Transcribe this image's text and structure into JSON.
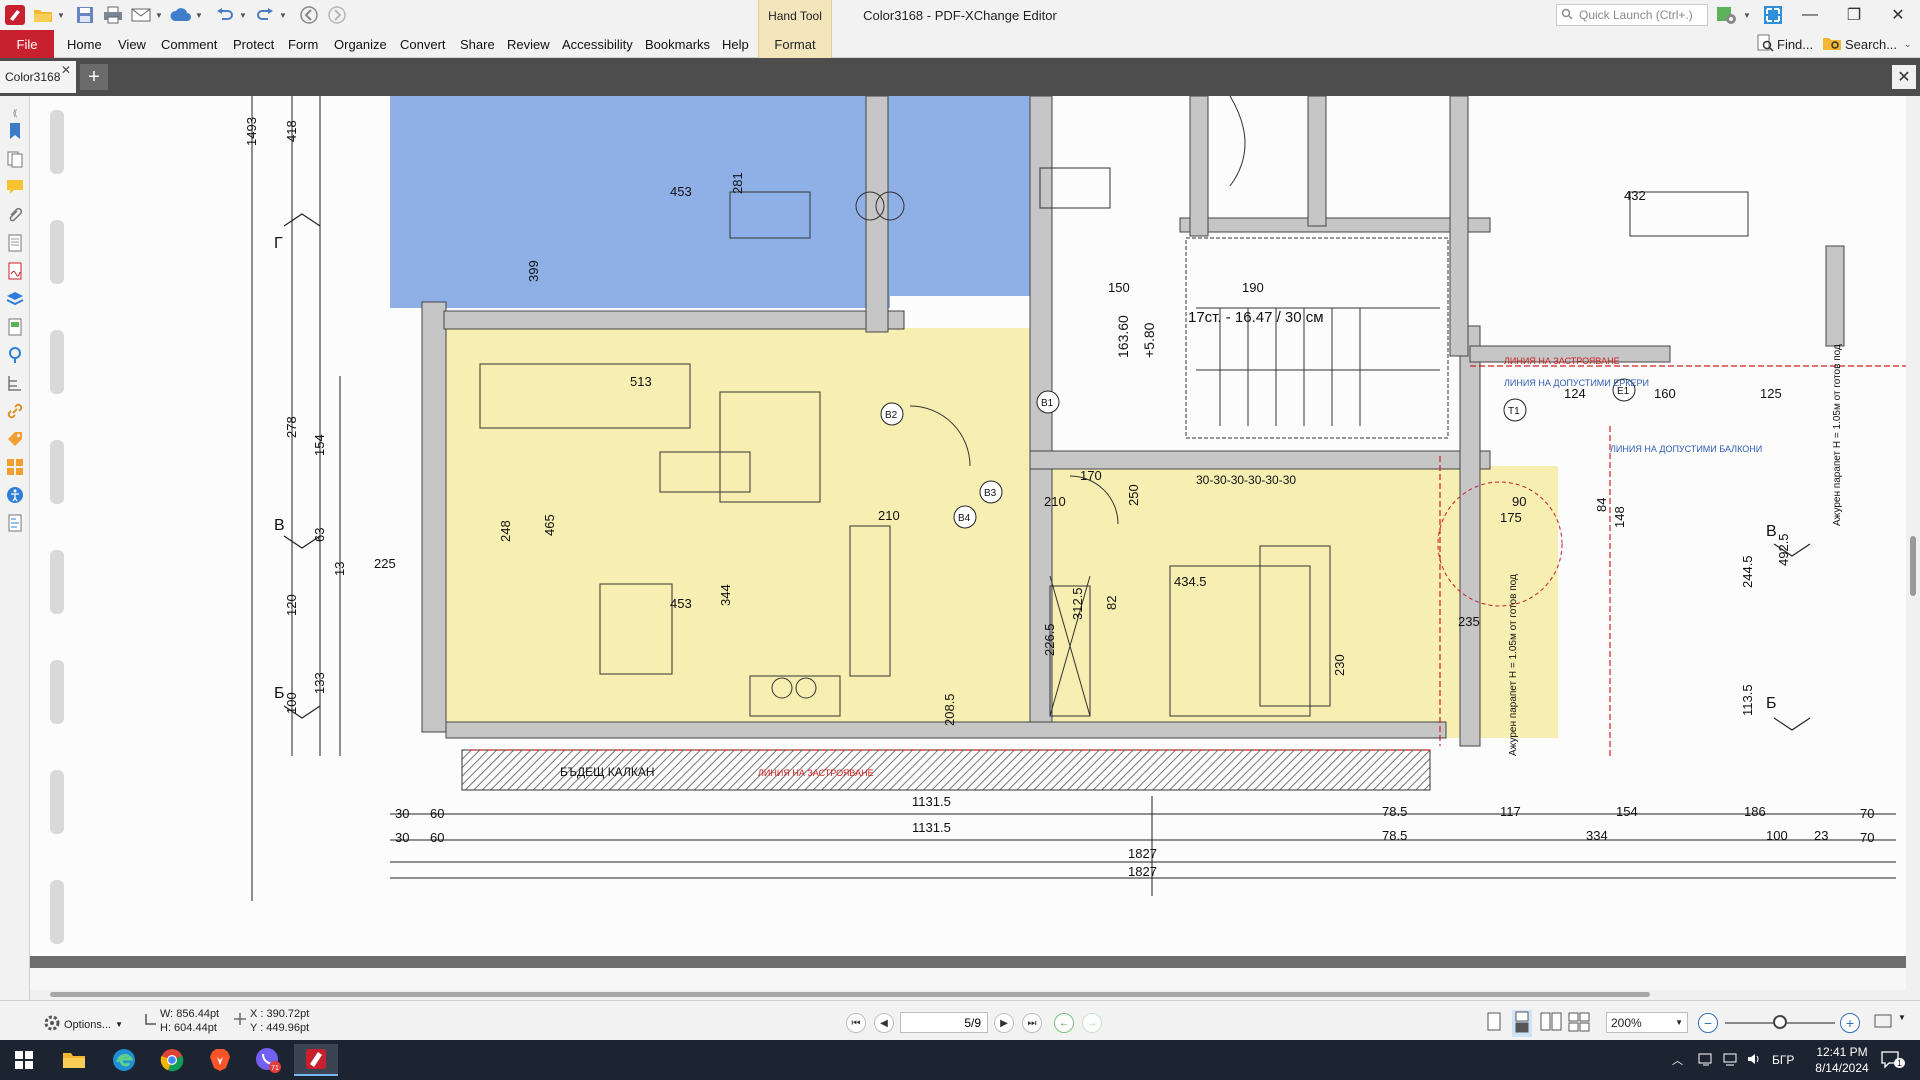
{
  "window": {
    "title": "Color3168 - PDF-XChange Editor",
    "minimize_icon": "minimize-icon",
    "restore_icon": "restore-icon",
    "close_icon": "close-icon"
  },
  "context_tab": {
    "title": "Hand Tool",
    "label": "Format"
  },
  "quick_launch": {
    "placeholder": "Quick Launch (Ctrl+.)"
  },
  "menu": {
    "file": "File",
    "items": [
      "Home",
      "View",
      "Comment",
      "Protect",
      "Form",
      "Organize",
      "Convert",
      "Share",
      "Review",
      "Accessibility",
      "Bookmarks",
      "Help"
    ]
  },
  "ribbon_right": {
    "find": "Find...",
    "search": "Search..."
  },
  "tabs": {
    "document": "Color3168"
  },
  "status": {
    "options": "Options...",
    "width": "W: 856.44pt",
    "height": "H: 604.44pt",
    "x": "X : 390.72pt",
    "y": "Y : 449.96pt",
    "page": "5/9",
    "zoom": "200%"
  },
  "taskbar": {
    "time": "12:41 PM",
    "date": "8/14/2024",
    "lang": "БГР",
    "notification_count": "1",
    "viber_badge": "71"
  },
  "colors": {
    "accent": "#c8202f",
    "room_blue": "#8fb0e6",
    "room_yellow": "#f7eeb2",
    "hatch": "#777777",
    "wall": "#c6c6c6"
  },
  "plan": {
    "labels": {
      "staircase": "17ст. - 16.47 / 30 см",
      "future_gable": "БЪДЕЩ КАЛКАН",
      "build_line": "ЛИНИЯ НА ЗАСТРОЯВАНЕ",
      "build_line_2": "ЛИНИЯ НА ЗАСТРОЯВАНЕ",
      "balcony_line": "ЛИНИЯ НА ДОПУСТИМИ ЕРКЕРИ",
      "balcony_line_2": "ЛИНИЯ НА ДОПУСТИМИ БАЛКОНИ",
      "parapet": "Ажурен парапет H = 1.05м от готов под",
      "parapet_2": "Ажурен парапет H = 1.05м от готов под",
      "elev": "+5.80",
      "d_163": "163.60",
      "section_g": "Г",
      "section_v_left": "В",
      "section_b_left": "Б",
      "section_v_right": "В",
      "section_b_right": "Б",
      "room_453_top": "453",
      "room_453_mid": "453",
      "room_4345": "434.5",
      "room_432": "432",
      "d_1131_5a": "1131.5",
      "d_1131_5b": "1131.5",
      "d_1827a": "1827",
      "d_1827b": "1827",
      "d_78_5a": "78.5",
      "d_78_5b": "78.5",
      "d_117": "117",
      "d_154": "154",
      "d_186": "186",
      "d_334": "334",
      "d_100": "100",
      "d_23": "23",
      "d_70a": "70",
      "d_70b": "70",
      "d_30a": "30",
      "d_60a": "60",
      "d_30b": "30",
      "d_60b": "60",
      "d_1493": "1493",
      "d_418": "418",
      "d_278": "278",
      "d_154v": "154",
      "d_63": "63",
      "d_13": "13",
      "d_120": "120",
      "d_133": "133",
      "d_100v": "100",
      "d_5135": "513",
      "d_399": "399",
      "d_281": "281",
      "d_3125": "312.5",
      "d_2265": "226.5",
      "d_344": "344",
      "d_465": "465",
      "d_4925": "492.5",
      "d_2445": "244.5",
      "d_1135": "113.5",
      "d_150": "150",
      "d_190": "190",
      "d_160": "160",
      "d_124": "124",
      "d_125": "125",
      "d_170": "170",
      "d_250": "250",
      "d_82": "82",
      "d_230": "230",
      "d_2085": "208.5",
      "d_210a": "210",
      "d_210b": "210",
      "d_90": "90",
      "d_175": "175",
      "d_148": "148",
      "d_84": "84",
      "d_30x": "30-30-30-30-30-30",
      "d_225": "225",
      "d_235": "235",
      "d_248": "248",
      "tag_b1": "B1",
      "tag_b2": "B2",
      "tag_b3": "B3",
      "tag_b4": "B4",
      "tag_t1": "T1",
      "tag_e1": "E1"
    }
  }
}
